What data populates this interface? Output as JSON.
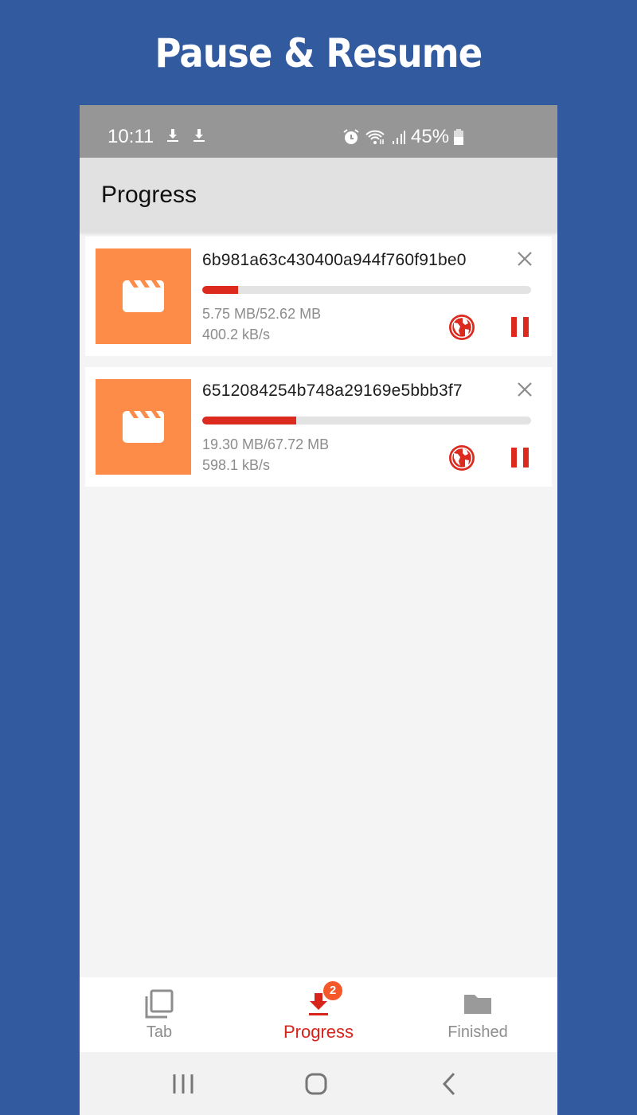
{
  "banner": {
    "title": "Pause & Resume"
  },
  "statusbar": {
    "time": "10:11",
    "left_icons": [
      "download-icon",
      "download-icon"
    ],
    "right_icons": [
      "alarm-icon",
      "wifi-icon",
      "signal-icon"
    ],
    "battery": "45%"
  },
  "appbar": {
    "title": "Progress"
  },
  "downloads": [
    {
      "name": "6b981a63c430400a944f760f91be0",
      "size": "5.75 MB/52.62 MB",
      "speed": "400.2 kB/s",
      "progress_fraction": 0.109,
      "thumbnail_icon": "video-clapper-icon",
      "actions": [
        "close-icon",
        "globe-icon",
        "pause-icon"
      ]
    },
    {
      "name": "6512084254b748a29169e5bbb3f7",
      "size": "19.30 MB/67.72 MB",
      "speed": "598.1 kB/s",
      "progress_fraction": 0.285,
      "thumbnail_icon": "video-clapper-icon",
      "actions": [
        "close-icon",
        "globe-icon",
        "pause-icon"
      ]
    }
  ],
  "bottom_nav": {
    "items": [
      {
        "label": "Tab",
        "icon": "tabs-icon",
        "active": false
      },
      {
        "label": "Progress",
        "icon": "download-icon",
        "active": true,
        "badge": "2"
      },
      {
        "label": "Finished",
        "icon": "folder-icon",
        "active": false
      }
    ]
  },
  "colors": {
    "background": "#325a9f",
    "accent": "#dc2a1f",
    "thumbnail": "#fd8c48",
    "badge": "#f5592a"
  }
}
